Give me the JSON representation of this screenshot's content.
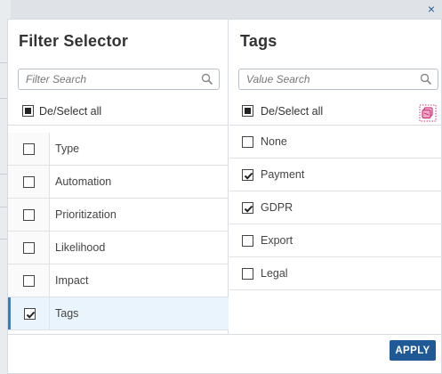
{
  "close_symbol": "×",
  "left_panel": {
    "title": "Filter Selector",
    "search_placeholder": "Filter Search",
    "select_all_label": "De/Select all",
    "items": [
      {
        "label": "Type",
        "checked": false
      },
      {
        "label": "Automation",
        "checked": false
      },
      {
        "label": "Prioritization",
        "checked": false
      },
      {
        "label": "Likelihood",
        "checked": false
      },
      {
        "label": "Impact",
        "checked": false
      },
      {
        "label": "Tags",
        "checked": true
      }
    ]
  },
  "right_panel": {
    "title": "Tags",
    "search_placeholder": "Value Search",
    "select_all_label": "De/Select all",
    "items": [
      {
        "label": "None",
        "checked": false
      },
      {
        "label": "Payment",
        "checked": true
      },
      {
        "label": "GDPR",
        "checked": true
      },
      {
        "label": "Export",
        "checked": false
      },
      {
        "label": "Legal",
        "checked": false
      }
    ]
  },
  "footer": {
    "apply_label": "APPLY"
  },
  "colors": {
    "accent": "#1f5a96",
    "active_bar": "#2d7fd3",
    "clear_icon": "#d4317a"
  },
  "icons": [
    "close-icon",
    "search-icon",
    "clear-selection-icon",
    "checkbox-icon"
  ]
}
